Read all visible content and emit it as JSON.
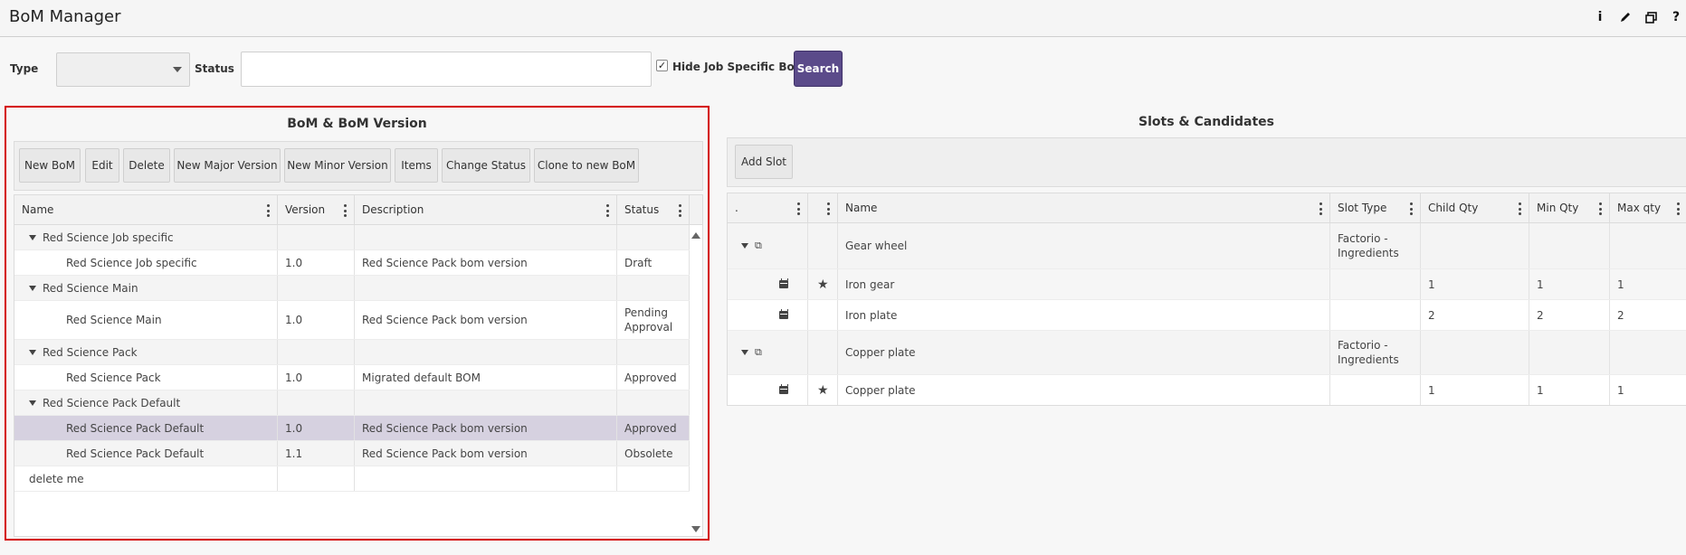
{
  "app": {
    "title": "BoM Manager"
  },
  "top_icons": [
    "info-icon",
    "pencil-icon",
    "window-icon",
    "help-icon"
  ],
  "filters": {
    "type_label": "Type",
    "type_value": "",
    "status_label": "Status",
    "status_value": "",
    "hide_job_specific_label": "Hide Job Specific BoMs",
    "hide_job_specific_checked": true,
    "search_label": "Search"
  },
  "colors": {
    "accent": "#5b4b8a",
    "selected_row": "#d6d1e0",
    "highlight_border": "#d40000"
  },
  "bom_panel": {
    "title": "BoM & BoM Version",
    "buttons": [
      "New BoM",
      "Edit",
      "Delete",
      "New Major Version",
      "New Minor Version",
      "Items",
      "Change Status",
      "Clone to new BoM"
    ],
    "columns": [
      "Name",
      "Version",
      "Description",
      "Status"
    ],
    "rows": [
      {
        "name": "Red Science Job specific",
        "version": "",
        "description": "",
        "status": "",
        "level": 0,
        "expander": true
      },
      {
        "name": "Red Science Job specific",
        "version": "1.0",
        "description": "Red Science Pack bom version",
        "status": "Draft",
        "level": 1
      },
      {
        "name": "Red Science Main",
        "version": "",
        "description": "",
        "status": "",
        "level": 0,
        "expander": true
      },
      {
        "name": "Red Science Main",
        "version": "1.0",
        "description": "Red Science Pack bom version",
        "status": "Pending Approval",
        "level": 1
      },
      {
        "name": "Red Science Pack",
        "version": "",
        "description": "",
        "status": "",
        "level": 0,
        "expander": true
      },
      {
        "name": "Red Science Pack",
        "version": "1.0",
        "description": "Migrated default BOM",
        "status": "Approved",
        "level": 1
      },
      {
        "name": "Red Science Pack Default",
        "version": "",
        "description": "",
        "status": "",
        "level": 0,
        "expander": true
      },
      {
        "name": "Red Science Pack Default",
        "version": "1.0",
        "description": "Red Science Pack bom version",
        "status": "Approved",
        "level": 1,
        "selected": true
      },
      {
        "name": "Red Science Pack Default",
        "version": "1.1",
        "description": "Red Science Pack bom version",
        "status": "Obsolete",
        "level": 1
      },
      {
        "name": "delete me",
        "version": "",
        "description": "",
        "status": "",
        "level": 0,
        "expander": false
      }
    ]
  },
  "slots_panel": {
    "title": "Slots & Candidates",
    "add_slot_label": "Add Slot",
    "columns": [
      ".",
      "",
      "Name",
      "Slot Type",
      "Child Qty",
      "Min Qty",
      "Max qty"
    ],
    "rows": [
      {
        "type": "slot",
        "name": "Gear wheel",
        "slot_type": "Factorio - Ingredients",
        "child_qty": "",
        "min_qty": "",
        "max_qty": ""
      },
      {
        "type": "candidate",
        "starred": true,
        "name": "Iron gear",
        "slot_type": "",
        "child_qty": "1",
        "min_qty": "1",
        "max_qty": "1"
      },
      {
        "type": "candidate",
        "starred": false,
        "name": "Iron plate",
        "slot_type": "",
        "child_qty": "2",
        "min_qty": "2",
        "max_qty": "2"
      },
      {
        "type": "slot",
        "name": "Copper plate",
        "slot_type": "Factorio - Ingredients",
        "child_qty": "",
        "min_qty": "",
        "max_qty": ""
      },
      {
        "type": "candidate",
        "starred": true,
        "name": "Copper plate",
        "slot_type": "",
        "child_qty": "1",
        "min_qty": "1",
        "max_qty": "1"
      }
    ]
  }
}
